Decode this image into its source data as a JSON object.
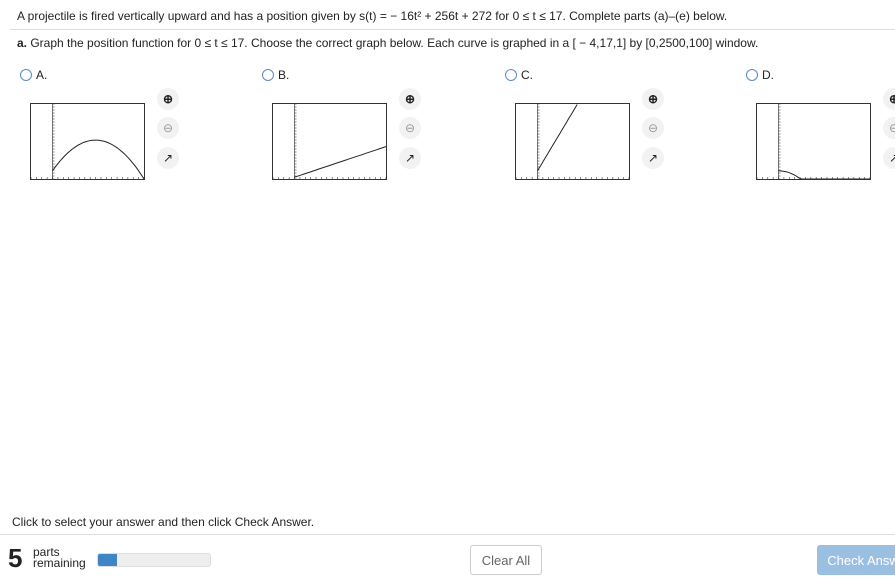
{
  "question": {
    "intro": "A projectile is fired vertically upward and has a position given by s(t) = − 16t² + 256t + 272 for 0 ≤ t ≤ 17. Complete parts (a)–(e) below.",
    "part_a_label": "a.",
    "part_a": " Graph the position function for 0 ≤ t ≤ 17. Choose the correct graph below. Each curve is graphed in a [ − 4,17,1] by [0,2500,100] window."
  },
  "options": [
    {
      "label": "A."
    },
    {
      "label": "B."
    },
    {
      "label": "C."
    },
    {
      "label": "D."
    }
  ],
  "window": {
    "xmin": -4,
    "xmax": 17,
    "xscl": 1,
    "ymin": 0,
    "ymax": 2500,
    "yscl": 100
  },
  "icons": [
    "zoom-in-icon",
    "zoom-out-icon",
    "popout-icon"
  ],
  "footer": {
    "instruction": "Click to select your answer and then click Check Answer.",
    "parts_count": "5",
    "parts_line1": "parts",
    "parts_line2": "remaining",
    "progress_percent": 17,
    "clear_all": "Clear All",
    "check_answer": "Check Answ"
  },
  "colors": {
    "accent": "#3d85c6",
    "check_button": "#9bbfe0",
    "radio": "#5b8ac6"
  }
}
